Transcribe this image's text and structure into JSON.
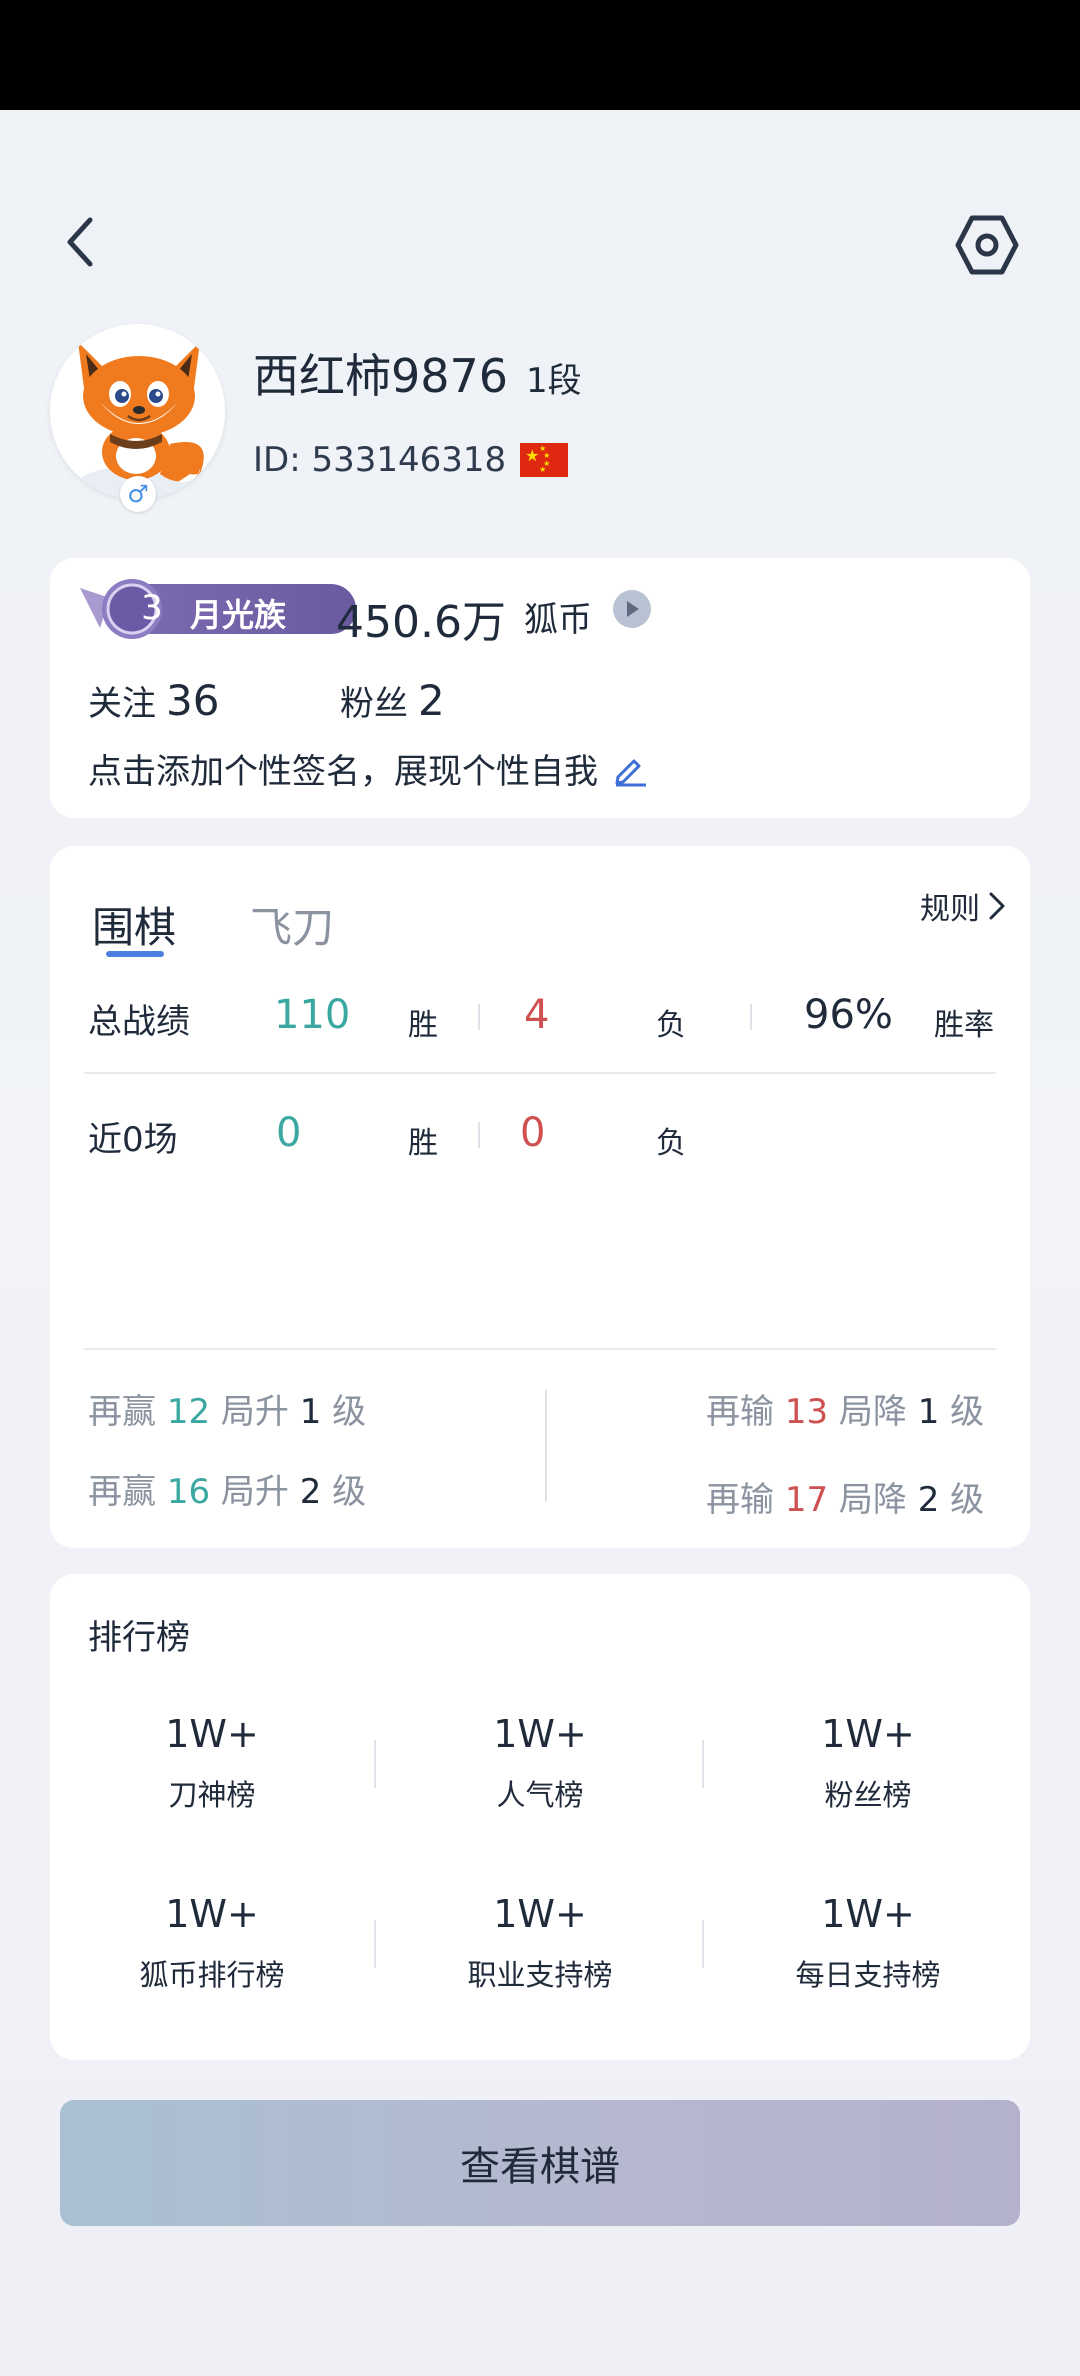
{
  "header": {
    "back_icon": "chevron-left-icon",
    "settings_icon": "hexagon-settings-icon"
  },
  "profile": {
    "username": "西红柿9876",
    "rank": "1段",
    "id_text": "ID: 533146318",
    "gender_icon": "male-symbol-icon",
    "flag": "china-flag-icon"
  },
  "wallet": {
    "level_number": "3",
    "level_name": "月光族",
    "coin_amount": "450.6万",
    "coin_label": "狐币",
    "follow_label": "关注",
    "follow_count": "36",
    "fans_label": "粉丝",
    "fans_count": "2",
    "signature_prompt": "点击添加个性签名，展现个性自我"
  },
  "record": {
    "tabs": [
      "围棋",
      "飞刀"
    ],
    "rules_label": "规则",
    "total": {
      "label": "总战绩",
      "wins": "110",
      "win_label": "胜",
      "losses": "4",
      "loss_label": "负",
      "win_rate": "96%",
      "win_rate_label": "胜率"
    },
    "recent": {
      "label": "近0场",
      "wins": "0",
      "win_label": "胜",
      "losses": "0",
      "loss_label": "负"
    },
    "promotion": [
      {
        "prefix": "再赢",
        "count": "12",
        "mid": "局升",
        "level": "1",
        "suffix": "级"
      },
      {
        "prefix": "再赢",
        "count": "16",
        "mid": "局升",
        "level": "2",
        "suffix": "级"
      }
    ],
    "demotion": [
      {
        "prefix": "再输",
        "count": "13",
        "mid": "局降",
        "level": "1",
        "suffix": "级"
      },
      {
        "prefix": "再输",
        "count": "17",
        "mid": "局降",
        "level": "2",
        "suffix": "级"
      }
    ]
  },
  "leaderboard": {
    "title": "排行榜",
    "items": [
      {
        "value": "1W+",
        "label": "刀神榜"
      },
      {
        "value": "1W+",
        "label": "人气榜"
      },
      {
        "value": "1W+",
        "label": "粉丝榜"
      },
      {
        "value": "1W+",
        "label": "狐币排行榜"
      },
      {
        "value": "1W+",
        "label": "职业支持榜"
      },
      {
        "value": "1W+",
        "label": "每日支持榜"
      }
    ]
  },
  "cta": {
    "label": "查看棋谱"
  },
  "colors": {
    "win": "#3aa8a0",
    "loss": "#cf5050",
    "accent": "#4d7fe0"
  }
}
